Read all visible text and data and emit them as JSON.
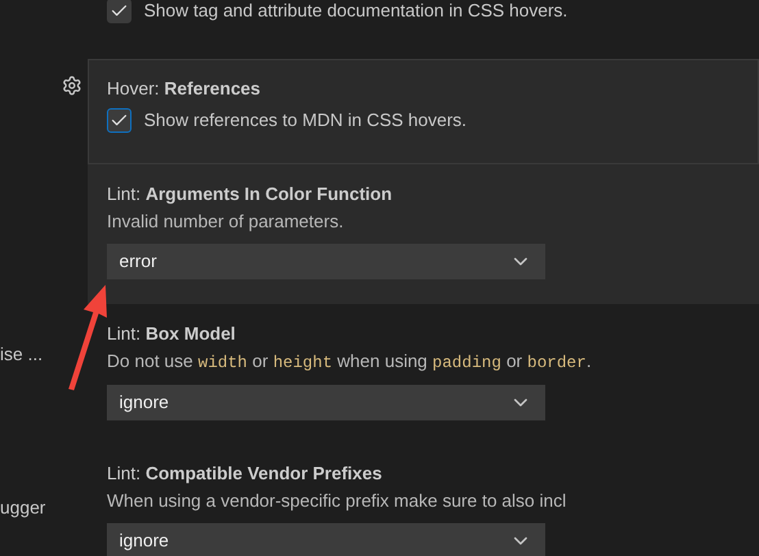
{
  "sidebar": {
    "items": [
      {
        "label": "ise ..."
      },
      {
        "label": "ugger"
      }
    ]
  },
  "settings": [
    {
      "kind": "checkbox",
      "label": "Show tag and attribute documentation in CSS hovers.",
      "checked": true,
      "focused": false,
      "highlighted": false
    },
    {
      "kind": "checkbox",
      "title": "Hover: **References**",
      "label": "Show references to MDN in CSS hovers.",
      "checked": true,
      "focused": true,
      "highlighted": true
    },
    {
      "kind": "select",
      "title": "Lint: **Arguments In Color Function**",
      "description": [
        {
          "text": "Invalid number of parameters.",
          "code": false
        }
      ],
      "value": "error",
      "focused": false,
      "highlighted": true
    },
    {
      "kind": "select",
      "title": "Lint: **Box Model**",
      "description": [
        {
          "text": "Do not use ",
          "code": false
        },
        {
          "text": "width",
          "code": true
        },
        {
          "text": " or ",
          "code": false
        },
        {
          "text": "height",
          "code": true
        },
        {
          "text": " when using ",
          "code": false
        },
        {
          "text": "padding",
          "code": true
        },
        {
          "text": " or ",
          "code": false
        },
        {
          "text": "border",
          "code": true
        },
        {
          "text": ".",
          "code": false
        }
      ],
      "value": "ignore",
      "focused": false,
      "highlighted": false
    },
    {
      "kind": "select",
      "title": "Lint: **Compatible Vendor Prefixes**",
      "description": [
        {
          "text": "When using a vendor-specific prefix make sure to also incl",
          "code": false
        }
      ],
      "value": "ignore",
      "focused": false,
      "highlighted": false
    }
  ]
}
